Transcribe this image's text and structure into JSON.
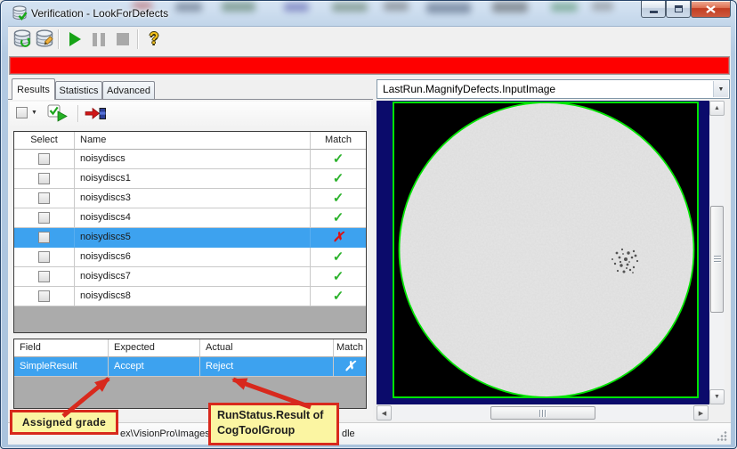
{
  "window": {
    "title": "Verification - LookForDefects"
  },
  "colors": {
    "banner_red": "#fe0000",
    "selection_blue": "#3da2ef",
    "pass_green": "#2cb22c",
    "fail_red": "#dd1111",
    "viewport_navy": "#0b0b6b",
    "graphic_green": "#00e400",
    "callout_bg": "#fbf5a2",
    "callout_border": "#d8291d"
  },
  "icons": {
    "app_icon": "database-verified-icon",
    "toolbar": [
      "open-image-database-icon",
      "edit-image-database-icon",
      "run-icon",
      "pause-icon",
      "stop-icon",
      "help-icon"
    ],
    "results_toolbar": [
      "select-all-dropdown",
      "run-checked-icon",
      "export-icon"
    ],
    "match_pass_glyph": "✓",
    "match_fail_glyph": "✗"
  },
  "glyphs": {
    "help": "?",
    "combo_arrow": "▼",
    "dropdown_arrow": "▼",
    "scroll_up": "▲",
    "scroll_down": "▼",
    "scroll_left": "◀",
    "scroll_right": "▶"
  },
  "tabs": {
    "items": [
      {
        "label": "Results",
        "active": true
      },
      {
        "label": "Statistics",
        "active": false
      },
      {
        "label": "Advanced",
        "active": false
      }
    ]
  },
  "results_table": {
    "columns": [
      "Select",
      "Name",
      "Match"
    ],
    "rows": [
      {
        "name": "noisydiscs",
        "checked": false,
        "match": "pass",
        "selected": false
      },
      {
        "name": "noisydiscs1",
        "checked": false,
        "match": "pass",
        "selected": false
      },
      {
        "name": "noisydiscs3",
        "checked": false,
        "match": "pass",
        "selected": false
      },
      {
        "name": "noisydiscs4",
        "checked": false,
        "match": "pass",
        "selected": false
      },
      {
        "name": "noisydiscs5",
        "checked": false,
        "match": "fail",
        "selected": true
      },
      {
        "name": "noisydiscs6",
        "checked": false,
        "match": "pass",
        "selected": false
      },
      {
        "name": "noisydiscs7",
        "checked": false,
        "match": "pass",
        "selected": false
      },
      {
        "name": "noisydiscs8",
        "checked": false,
        "match": "pass",
        "selected": false
      }
    ]
  },
  "detail_table": {
    "columns": [
      "Field",
      "Expected",
      "Actual",
      "Match"
    ],
    "rows": [
      {
        "field": "SimpleResult",
        "expected": "Accept",
        "actual": "Reject",
        "match": "fail",
        "selected": true
      }
    ]
  },
  "image_panel": {
    "display_selector": "LastRun.MagnifyDefects.InputImage"
  },
  "status_bar": {
    "path_fragment": "ex\\VisionPro\\Images",
    "state_fragment": "dle"
  },
  "callouts": [
    {
      "text": "Assigned grade"
    },
    {
      "line1": "RunStatus.Result of",
      "line2": "CogToolGroup"
    }
  ]
}
